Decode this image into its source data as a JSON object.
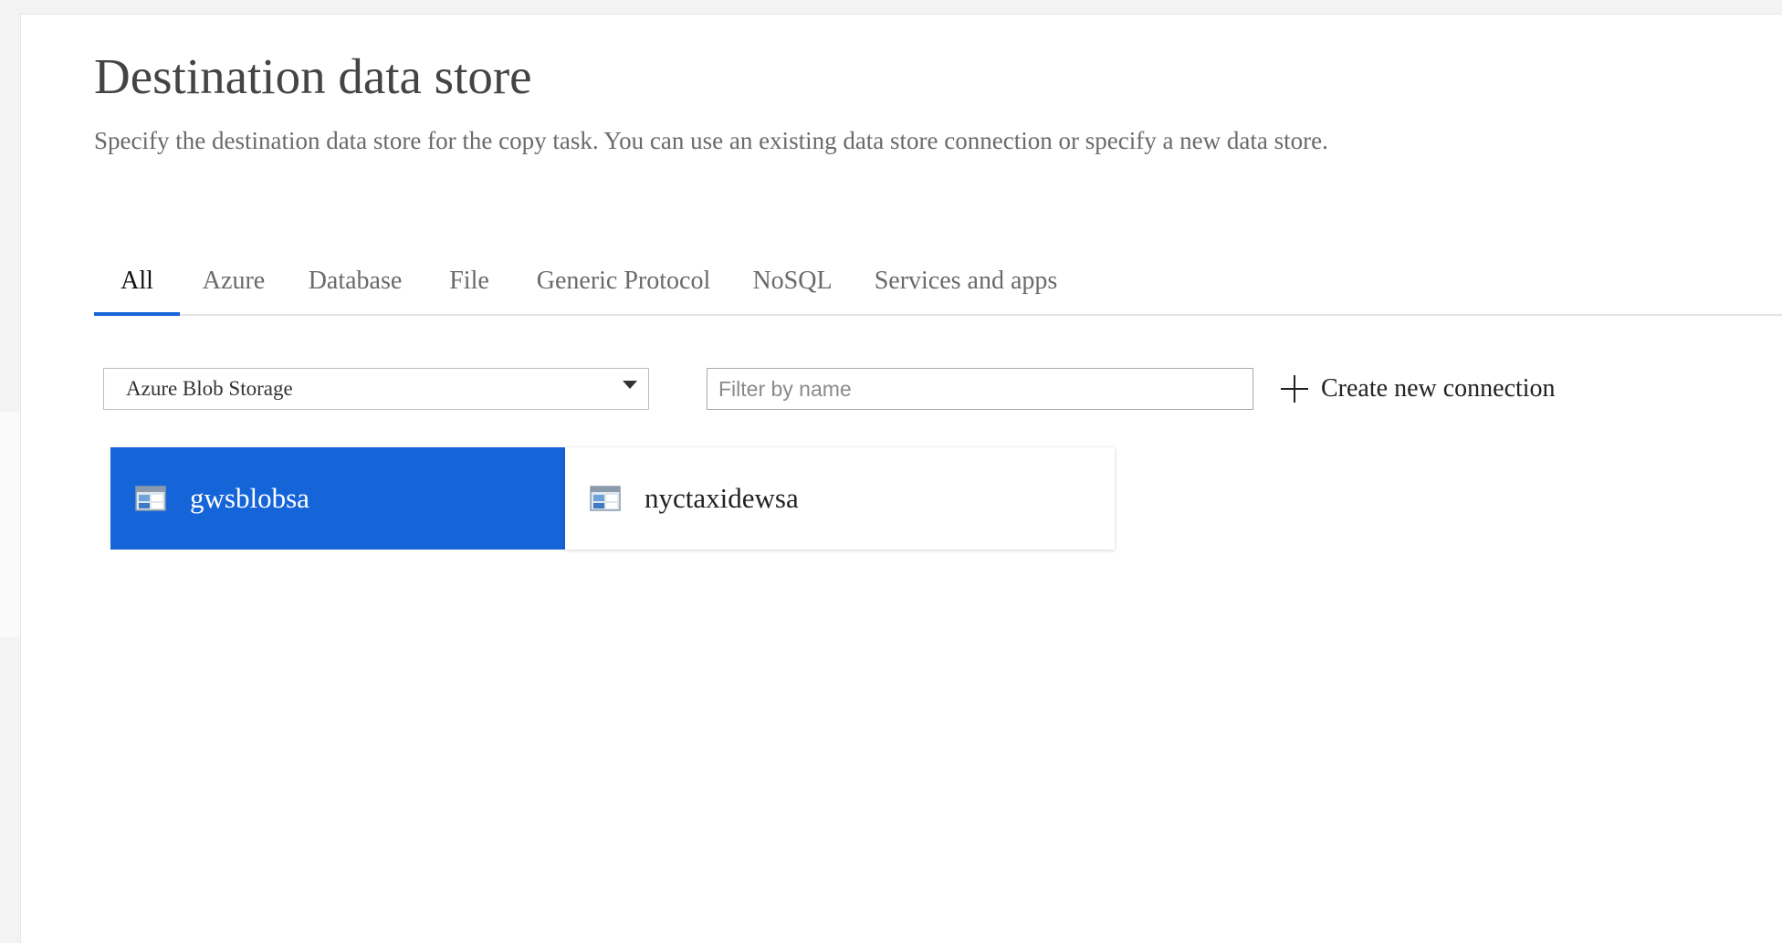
{
  "page": {
    "title": "Destination data store",
    "description": "Specify the destination data store for the copy task. You can use an existing data store connection or specify a new data store."
  },
  "tabs": [
    {
      "label": "All",
      "active": true
    },
    {
      "label": "Azure",
      "active": false
    },
    {
      "label": "Database",
      "active": false
    },
    {
      "label": "File",
      "active": false
    },
    {
      "label": "Generic Protocol",
      "active": false
    },
    {
      "label": "NoSQL",
      "active": false
    },
    {
      "label": "Services and apps",
      "active": false
    }
  ],
  "filters": {
    "store_type": {
      "selected": "Azure Blob Storage",
      "icon": "chevron-down-icon"
    },
    "search": {
      "value": "",
      "placeholder": "Filter by name"
    },
    "create_label": "Create new connection",
    "create_icon": "plus-icon"
  },
  "connections": [
    {
      "name": "gwsblobsa",
      "selected": true,
      "icon": "storage-icon"
    },
    {
      "name": "nyctaxidewsa",
      "selected": false,
      "icon": "storage-icon"
    }
  ],
  "colors": {
    "accent": "#1565d8",
    "title": "#444444",
    "muted_text": "#6a6a6a"
  }
}
